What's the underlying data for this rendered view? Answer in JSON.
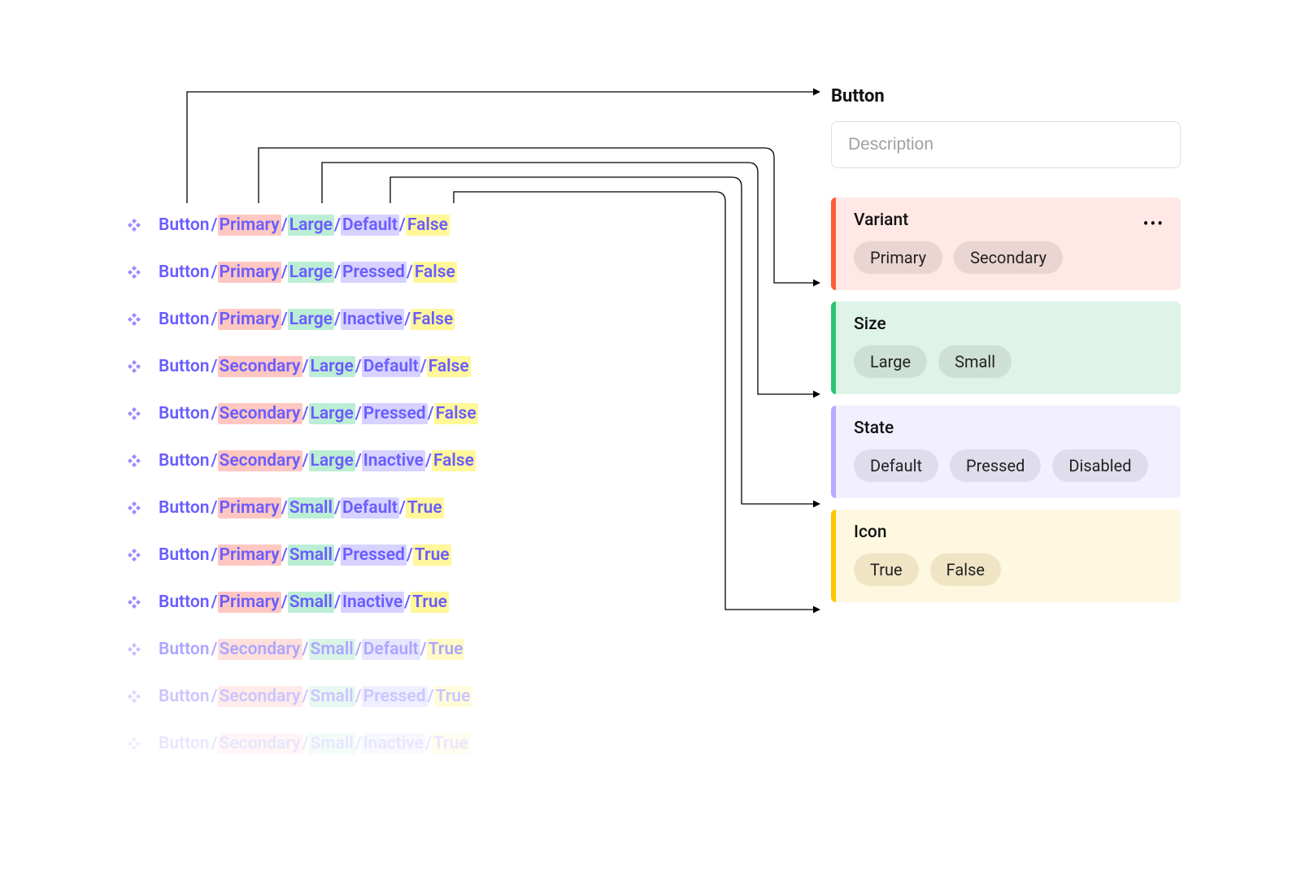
{
  "component": {
    "name": "Button",
    "description_placeholder": "Description"
  },
  "layers": [
    {
      "parts": [
        "Button",
        "Primary",
        "Large",
        "Default",
        "False"
      ],
      "fade": 0
    },
    {
      "parts": [
        "Button",
        "Primary",
        "Large",
        "Pressed",
        "False"
      ],
      "fade": 0
    },
    {
      "parts": [
        "Button",
        "Primary",
        "Large",
        "Inactive",
        "False"
      ],
      "fade": 0
    },
    {
      "parts": [
        "Button",
        "Secondary",
        "Large",
        "Default",
        "False"
      ],
      "fade": 0
    },
    {
      "parts": [
        "Button",
        "Secondary",
        "Large",
        "Pressed",
        "False"
      ],
      "fade": 0
    },
    {
      "parts": [
        "Button",
        "Secondary",
        "Large",
        "Inactive",
        "False"
      ],
      "fade": 0
    },
    {
      "parts": [
        "Button",
        "Primary",
        "Small",
        "Default",
        "True"
      ],
      "fade": 0
    },
    {
      "parts": [
        "Button",
        "Primary",
        "Small",
        "Pressed",
        "True"
      ],
      "fade": 0
    },
    {
      "parts": [
        "Button",
        "Primary",
        "Small",
        "Inactive",
        "True"
      ],
      "fade": 0
    },
    {
      "parts": [
        "Button",
        "Secondary",
        "Small",
        "Default",
        "True"
      ],
      "fade": 1
    },
    {
      "parts": [
        "Button",
        "Secondary",
        "Small",
        "Pressed",
        "True"
      ],
      "fade": 2
    },
    {
      "parts": [
        "Button",
        "Secondary",
        "Small",
        "Inactive",
        "True"
      ],
      "fade": 3
    }
  ],
  "layer_highlight_classes": [
    "",
    "hl-red",
    "hl-green",
    "hl-lilac",
    "hl-yellow"
  ],
  "properties": [
    {
      "name": "Variant",
      "class": "variant",
      "options": [
        "Primary",
        "Secondary"
      ],
      "show_more": true
    },
    {
      "name": "Size",
      "class": "size",
      "options": [
        "Large",
        "Small"
      ],
      "show_more": false
    },
    {
      "name": "State",
      "class": "state",
      "options": [
        "Default",
        "Pressed",
        "Disabled"
      ],
      "show_more": false
    },
    {
      "name": "Icon",
      "class": "icon",
      "options": [
        "True",
        "False"
      ],
      "show_more": false
    }
  ],
  "colors": {
    "purple_text": "#6a5cff"
  }
}
